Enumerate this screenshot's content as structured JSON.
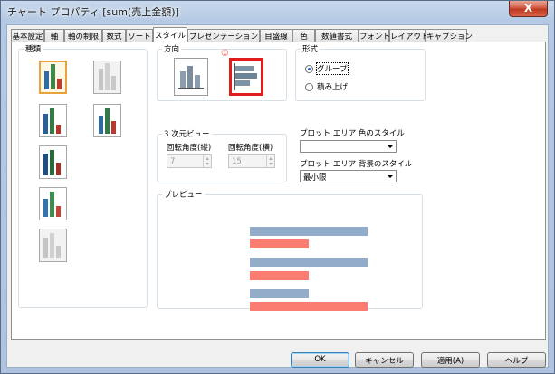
{
  "window": {
    "title": "チャート プロパティ [sum(売上金額)]",
    "close_glyph": "X"
  },
  "tabs": [
    "基本設定",
    "軸",
    "軸の制限",
    "数式",
    "ソート",
    "スタイル",
    "プレゼンテーション",
    "目盛線",
    "色",
    "数値書式",
    "フォント",
    "レイアウト",
    "キャプション"
  ],
  "active_tab": "スタイル",
  "type_group": {
    "label": "種類"
  },
  "direction_group": {
    "label": "方向",
    "marker": "①"
  },
  "form_group": {
    "label": "形式",
    "options": [
      "グループ",
      "積み上げ"
    ],
    "selected": "グループ"
  },
  "view3d_group": {
    "label": "3 次元ビュー",
    "vertical_label": "回転角度(縦)",
    "vertical_value": "7",
    "horizontal_label": "回転角度(横)",
    "horizontal_value": "15"
  },
  "plot_area_color": {
    "label": "プロット エリア 色のスタイル",
    "value": ""
  },
  "plot_area_bg": {
    "label": "プロット エリア 背景のスタイル",
    "value": "最小限"
  },
  "preview": {
    "label": "プレビュー",
    "series_colors": [
      "#93acca",
      "#fb7d72"
    ],
    "bars": [
      {
        "series": 0,
        "value": 1.0
      },
      {
        "series": 1,
        "value": 0.5
      },
      {
        "series": 0,
        "value": 1.0
      },
      {
        "series": 1,
        "value": 0.5
      },
      {
        "series": 0,
        "value": 0.5
      },
      {
        "series": 1,
        "value": 1.0
      }
    ]
  },
  "buttons": {
    "ok": "OK",
    "cancel": "キャンセル",
    "apply": "適用(A)",
    "help": "ヘルプ"
  },
  "colors": {
    "highlight_red": "#e01d1d",
    "selected_orange": "#e8a33d"
  }
}
